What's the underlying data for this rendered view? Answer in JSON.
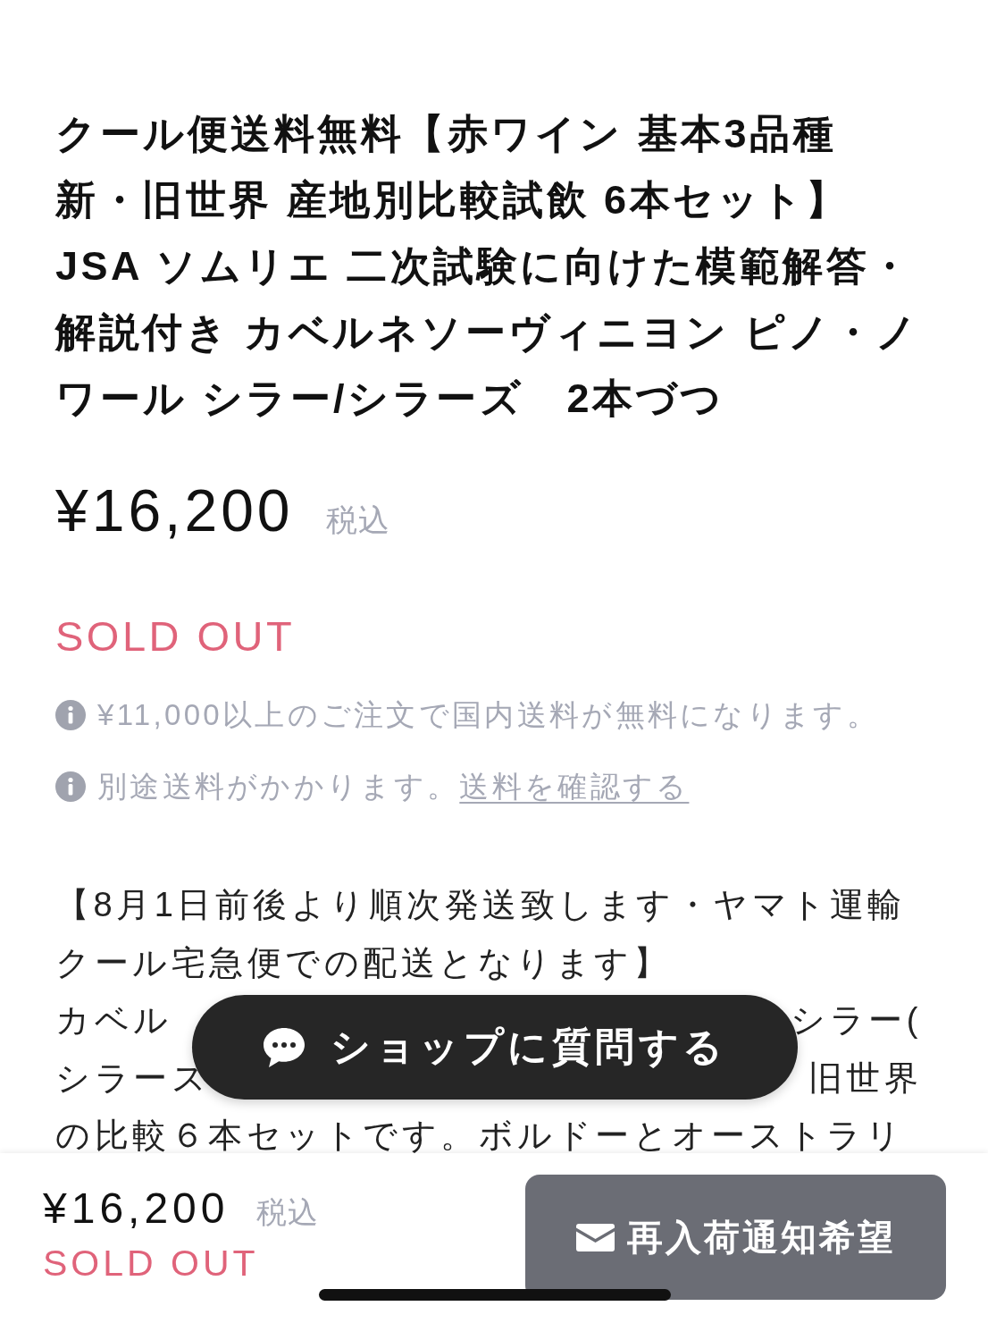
{
  "product": {
    "title_lines": [
      "クール便送料無料【赤ワイン 基本3品種",
      "新・旧世界 産地別比較試飲 6本セット】",
      "JSA ソムリエ 二次試験に向けた模範解答・",
      "解説付き カベルネソーヴィニヨン ピノ・ノ",
      "ワール シラー/シラーズ　2本づつ"
    ],
    "price": "¥16,200",
    "tax_note": "税込",
    "stock_status": "SOLD OUT"
  },
  "shipping_notes": [
    {
      "text": "¥11,000以上のご注文で国内送料が無料になります。"
    },
    {
      "text": "別途送料がかかります。",
      "link": "送料を確認する"
    }
  ],
  "description_lines": [
    [
      "【8月1日前後より順次発送致します・ヤマト運輸"
    ],
    [
      "クール宅急便での配送となります】"
    ],
    [
      "カベル",
      "シラー("
    ],
    [
      "シラース",
      "旧世界"
    ],
    [
      "の比較６本セットです。ボルドーとオーストラリ"
    ]
  ],
  "floating_button": {
    "label": "ショップに質問する"
  },
  "bottom_bar": {
    "price": "¥16,200",
    "tax_note": "税込",
    "stock_status": "SOLD OUT",
    "button": {
      "label": "再入荷通知希望"
    }
  }
}
